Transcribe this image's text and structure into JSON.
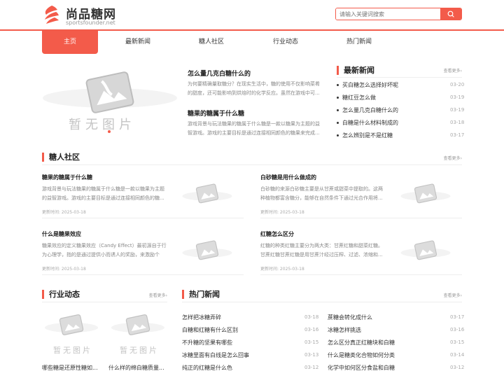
{
  "site": {
    "title": "尚品糖网",
    "domain": "sportsfounder.net",
    "brand_color": "#f35b4a"
  },
  "search": {
    "placeholder": "请输入关键词搜索",
    "icon": "search-icon"
  },
  "nav": [
    {
      "label": "主页",
      "active": true
    },
    {
      "label": "最新新闻"
    },
    {
      "label": "糖人社区"
    },
    {
      "label": "行业动态"
    },
    {
      "label": "热门新闻"
    }
  ],
  "placeholder_text": "暂无图片",
  "slider": {
    "articles": [
      {
        "title": "怎么量几克白糖什么的",
        "desc": "为何要精确量取糖分？在现实生活中，糖的使用不仅影响菜肴的甜度，还可能影响到烘焙时的化学反应。虽然在游戏中可..."
      },
      {
        "title": "糖果的糖属于什么糖",
        "desc": "游戏背景与玩法糖果的糖属于什么糖是一款以糖果为主题的益智游戏。游戏的主要目标是通过连接相同颜色的糖果来完成..."
      }
    ]
  },
  "latest": {
    "title": "最新新闻",
    "more": "查看更多›",
    "items": [
      {
        "title": "买白糖怎么选择好坏呢",
        "date": "03-20"
      },
      {
        "title": "糖红豆怎么做",
        "date": "03-19"
      },
      {
        "title": "怎么量几克白糖什么的",
        "date": "03-19"
      },
      {
        "title": "白糖是什么材料制成的",
        "date": "03-18"
      },
      {
        "title": "怎么辨别是不是红糖",
        "date": "03-17"
      }
    ]
  },
  "community": {
    "title": "糖人社区",
    "more": "查看更多›",
    "cards": [
      {
        "title": "糖果的糖属于什么糖",
        "desc": "游戏背景与玩法糖果的糖属于什么糖是一款以糖果为主题的益智游戏。游戏的主要目标是通过连接相同颜色的糖...",
        "time": "更新时间:  2025-03-18"
      },
      {
        "title": "白砂糖是用什么做成的",
        "desc": "白砂糖的来源白砂糖主要是从甘蔗或甜菜中提取的。这两种植物都富含糖分，能够在自然条件下通过光合作用将...",
        "time": "更新时间:  2025-03-18"
      },
      {
        "title": "什么是糖果效应",
        "desc": "糖果效应的定义糖果效应（Candy Effect）最初源自于行为心理学，指的是通过提供小而诱人的奖励，来激励个体...",
        "time": "更新时间:  2025-03-18"
      },
      {
        "title": "红糖怎么区分",
        "desc": "红糖的种类红糖主要分为两大类：甘蔗红糖和甜菜红糖。甘蔗红糖甘蔗红糖是用甘蔗汁经过压榨、过滤、浓缩和...",
        "time": "更新时间:  2025-03-18"
      }
    ]
  },
  "industry": {
    "title": "行业动态",
    "more": "查看更多›",
    "items": [
      {
        "title": "哪些糖是还原性糖如..."
      },
      {
        "title": "什么样的绵白糖质量..."
      }
    ]
  },
  "hot": {
    "title": "热门新闻",
    "more": "查看更多›",
    "left": [
      {
        "title": "怎样把冰糖弄碎",
        "date": "03-18"
      },
      {
        "title": "白糖和红糖有什么区别",
        "date": "03-16"
      },
      {
        "title": "不升糖的坚果有哪些",
        "date": "03-15"
      },
      {
        "title": "冰糖里面有白线是怎么回事",
        "date": "03-13"
      },
      {
        "title": "纯正的红糖是什么色",
        "date": "03-12"
      }
    ],
    "right": [
      {
        "title": "蔗糖会转化成什么",
        "date": "03-17"
      },
      {
        "title": "冰糖怎样挑选",
        "date": "03-16"
      },
      {
        "title": "怎么区分真正红糖块和白糖",
        "date": "03-15"
      },
      {
        "title": "什么是糖类化合物如何分类",
        "date": "03-14"
      },
      {
        "title": "化学中如何区分食盐和白糖",
        "date": "03-12"
      }
    ]
  }
}
